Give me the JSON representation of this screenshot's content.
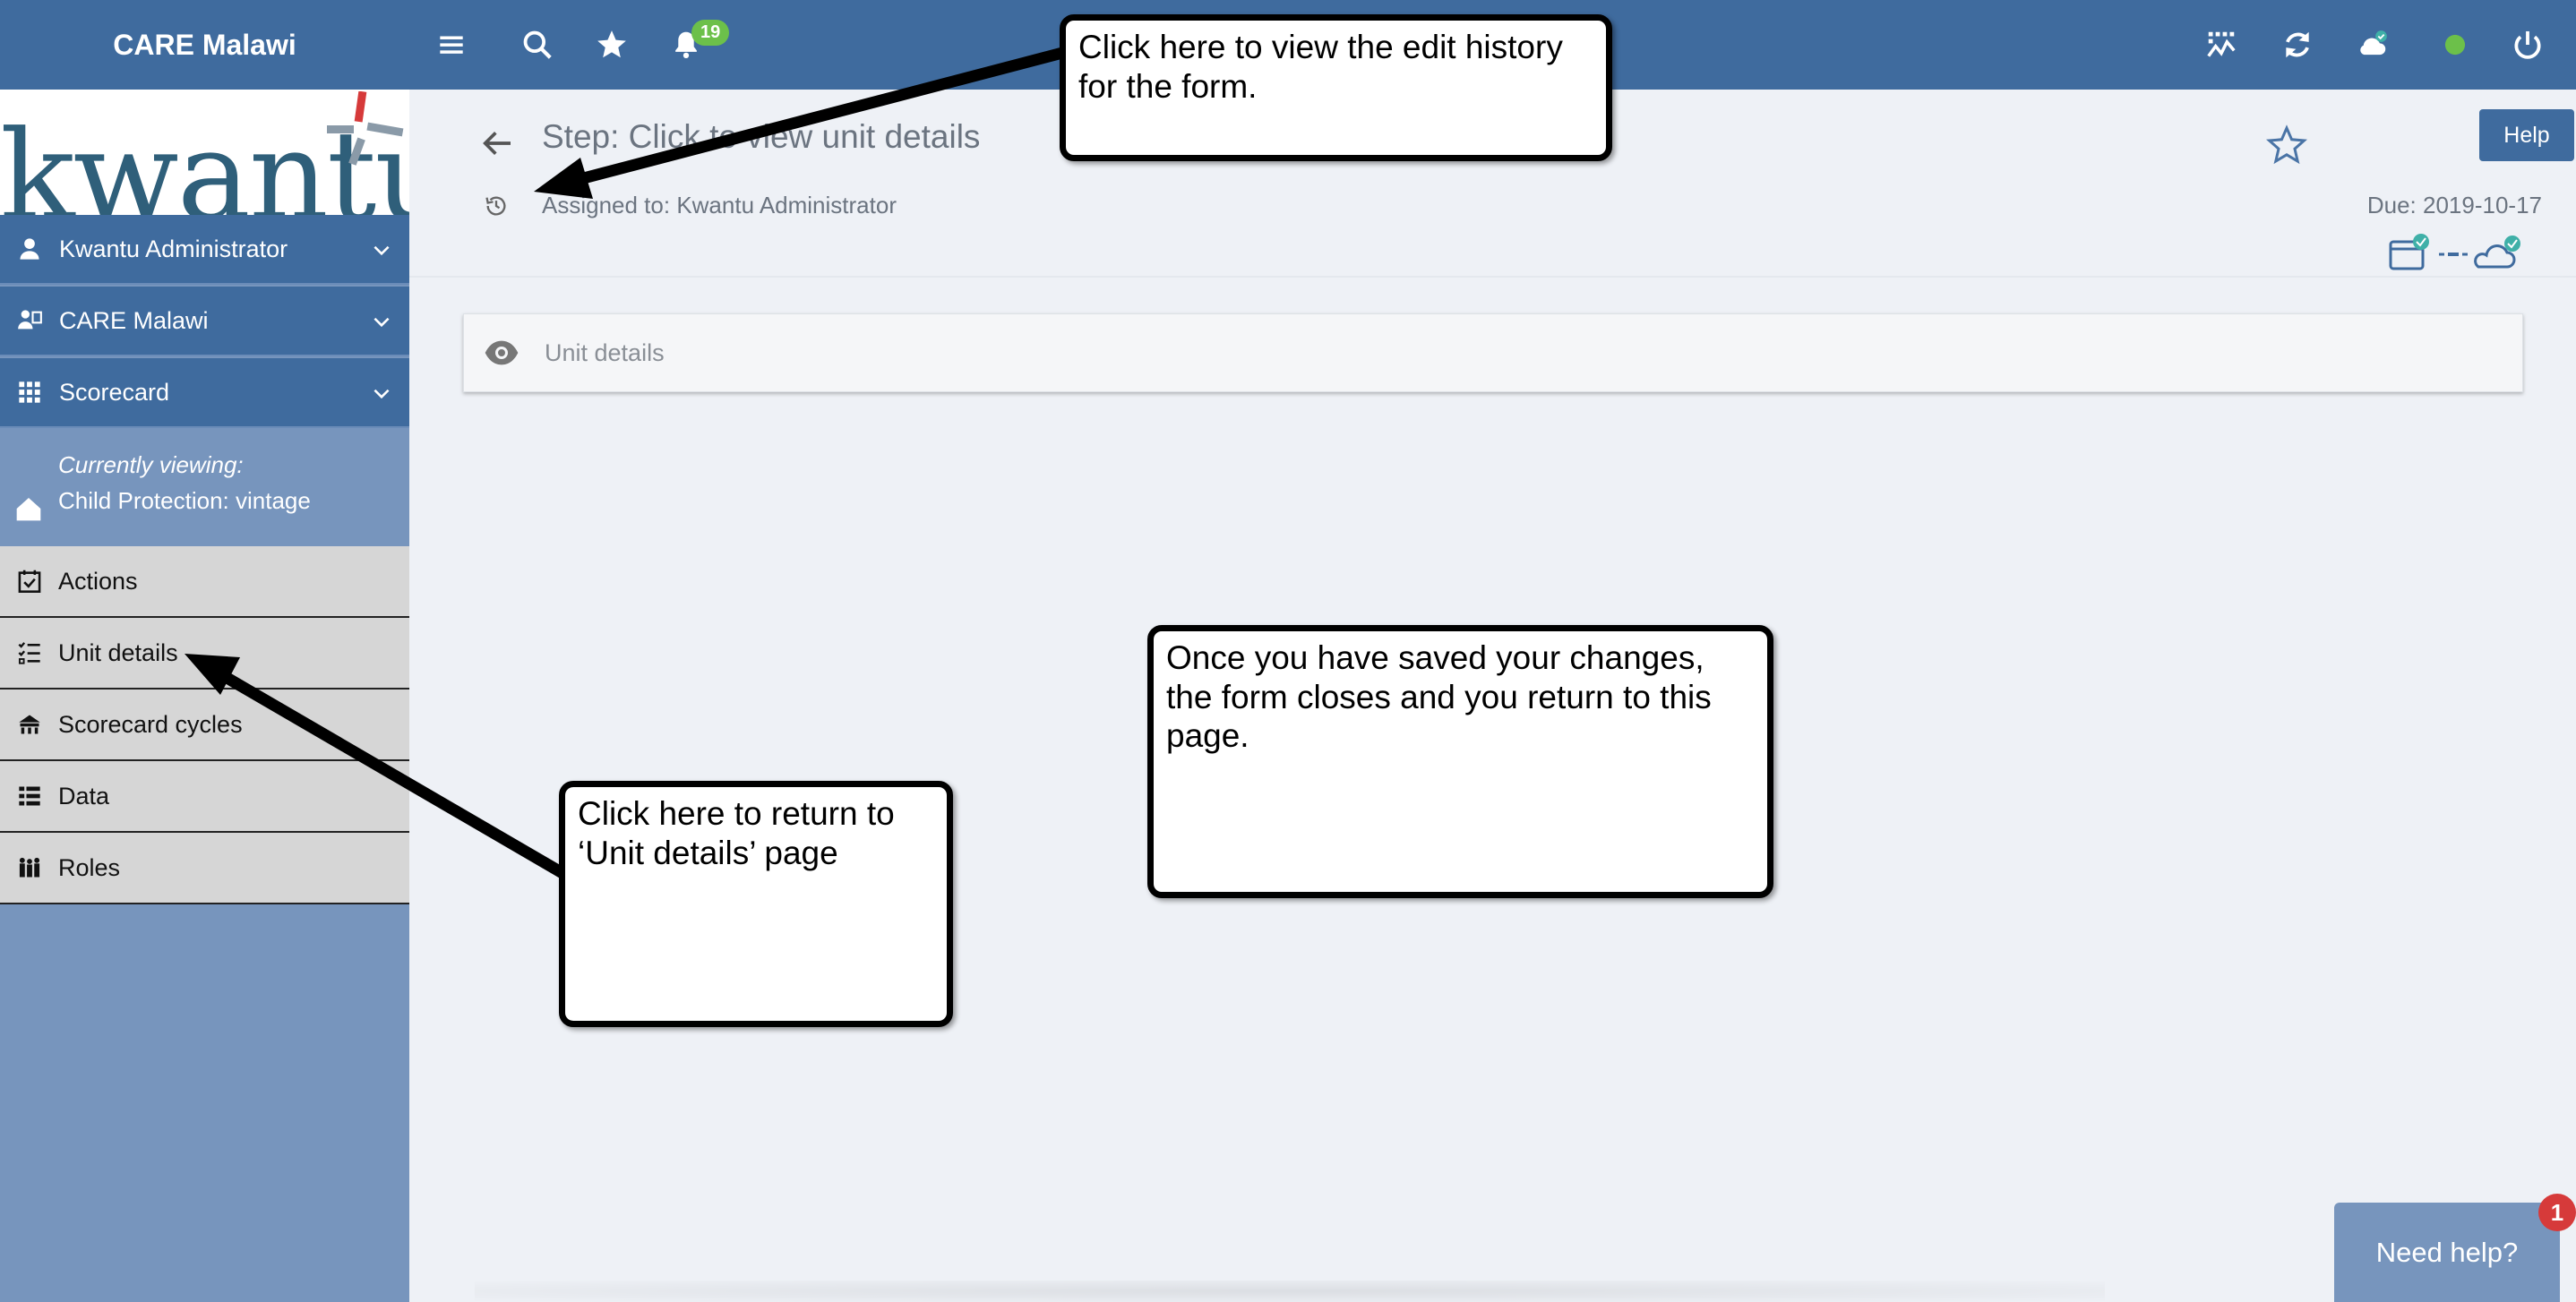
{
  "topbar": {
    "brand": "CARE Malawi",
    "notifications_count": "19",
    "status_color": "#6cc04a"
  },
  "sidebar": {
    "logo_text": "kwantu",
    "user_menu": "Kwantu Administrator",
    "org_menu": "CARE Malawi",
    "app_menu": "Scorecard",
    "viewing_label": "Currently viewing:",
    "viewing_value": "Child Protection: vintage",
    "items": [
      {
        "label": "Actions"
      },
      {
        "label": "Unit details"
      },
      {
        "label": "Scorecard cycles"
      },
      {
        "label": "Data"
      },
      {
        "label": "Roles"
      }
    ]
  },
  "main": {
    "step_title": "Step: Click to view unit details",
    "assigned": "Assigned to: Kwantu Administrator",
    "due": "Due: 2019-10-17",
    "help_label": "Help",
    "card_label": "Unit details"
  },
  "callouts": {
    "history": "Click here to view the edit history for the form.",
    "saved": "Once you have saved your changes, the form closes and you return to this page.",
    "return": "Click here to return to ‘Unit details’ page"
  },
  "need_help": {
    "label": "Need help?",
    "badge": "1"
  },
  "colors": {
    "primary": "#3f6b9e",
    "sidebar": "#7795bd",
    "background": "#eef1f6"
  }
}
